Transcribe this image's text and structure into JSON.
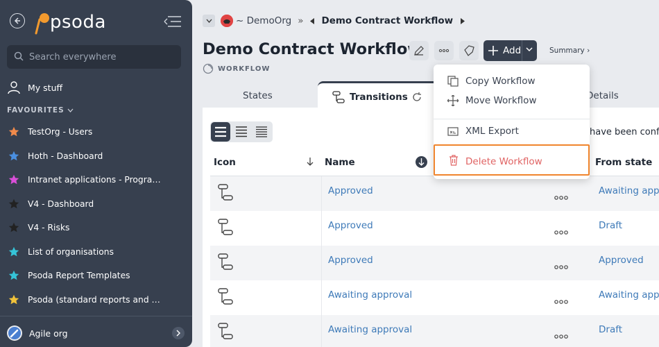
{
  "sidebar": {
    "logo_text": "psoda",
    "search_placeholder": "Search everywhere",
    "my_stuff": "My stuff",
    "favourites_header": "FAVOURITES",
    "items": [
      {
        "label": "TestOrg - Users",
        "star_color": "#f08a4b"
      },
      {
        "label": "Hoth - Dashboard",
        "star_color": "#4a8fe0"
      },
      {
        "label": "Intranet applications - Programme...",
        "star_color": "#d94fd8"
      },
      {
        "label": "V4 - Dashboard",
        "star_color": "#222222"
      },
      {
        "label": "V4 - Risks",
        "star_color": "#222222"
      },
      {
        "label": "List of organisations",
        "star_color": "#35c4d8"
      },
      {
        "label": "Psoda Report Templates",
        "star_color": "#35c4d8"
      },
      {
        "label": "Psoda (standard reports and work...",
        "star_color": "#f0c23a"
      }
    ],
    "org": "Agile org"
  },
  "breadcrumb": {
    "org": "~ DemoOrg",
    "sep": "»",
    "current": "Demo Contract Workflow"
  },
  "header": {
    "title": "Demo Contract Workflow",
    "type": "WORKFLOW",
    "add_label": "Add",
    "summary": "Summary ›"
  },
  "tabs": {
    "states": "States",
    "transitions": "Transitions",
    "details": "Details"
  },
  "menu": {
    "copy": "Copy Workflow",
    "move": "Move Workflow",
    "xml": "XML Export",
    "delete": "Delete Workflow"
  },
  "info_text": "have been confi",
  "table": {
    "headers": {
      "icon": "Icon",
      "name": "Name",
      "from": "From state"
    },
    "rows": [
      {
        "name": "Approved",
        "from": "Awaiting appro"
      },
      {
        "name": "Approved",
        "from": "Draft"
      },
      {
        "name": "Approved",
        "from": "Approved"
      },
      {
        "name": "Awaiting approval",
        "from": "Awaiting appro"
      },
      {
        "name": "Awaiting approval",
        "from": "Draft"
      }
    ]
  },
  "colors": {
    "sidebar_bg": "#37404f",
    "link": "#3e7ab8",
    "highlight": "#f0852d",
    "delete": "#e06363"
  }
}
